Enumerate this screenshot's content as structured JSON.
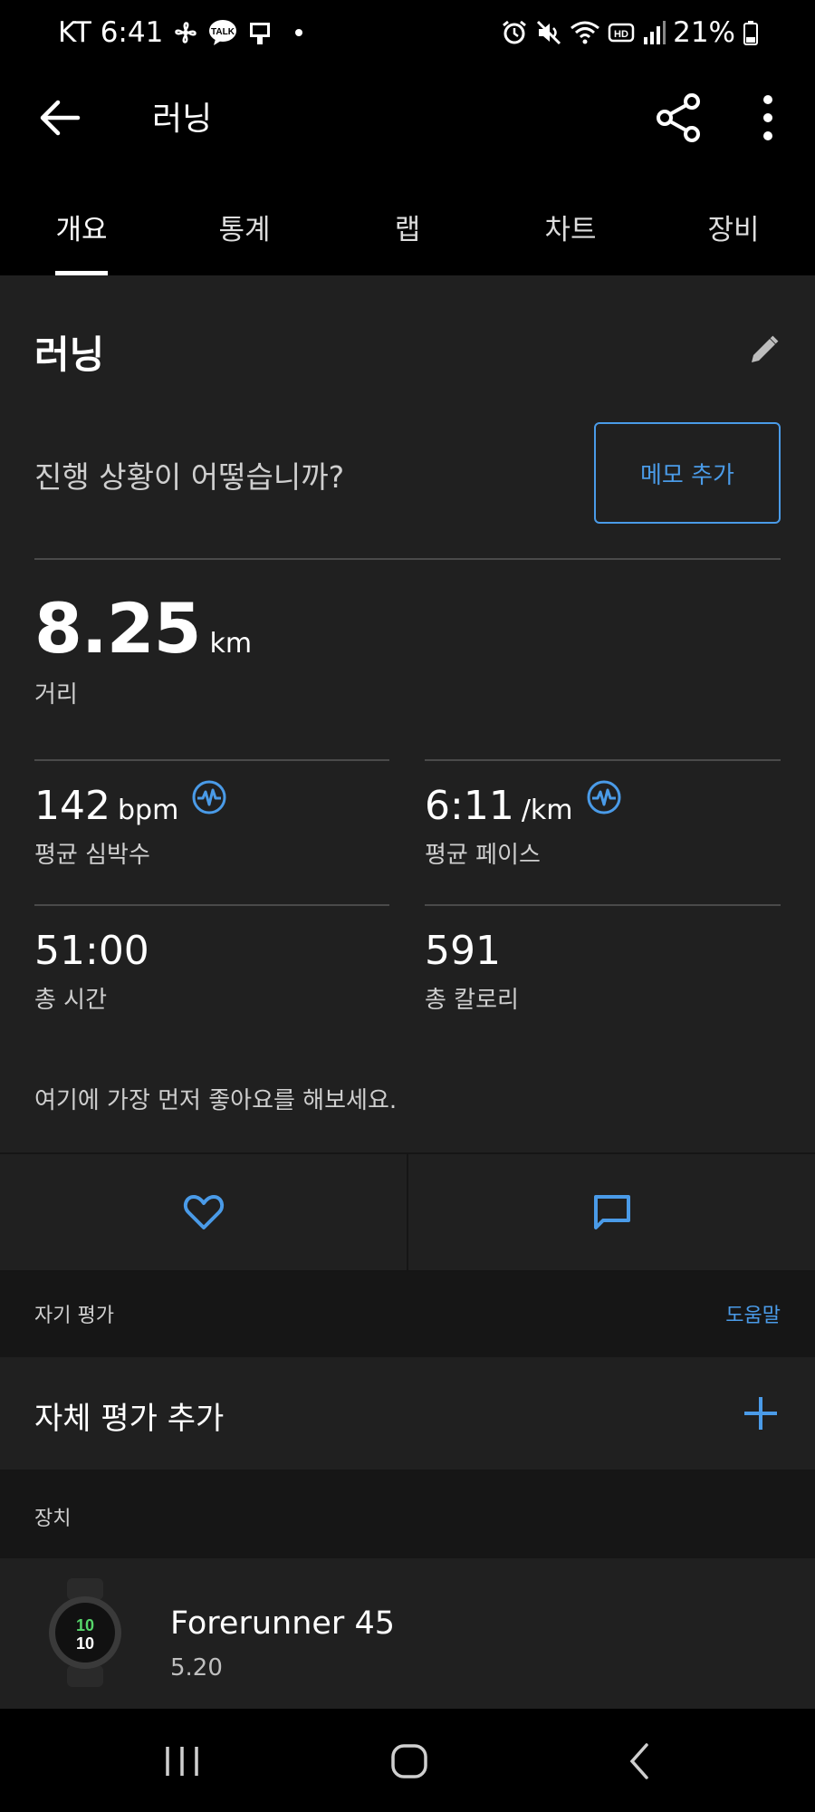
{
  "status_bar": {
    "carrier_time": "KT 6:41",
    "battery": "21%",
    "icons": [
      "pinwheel-icon",
      "talk-icon",
      "device-icon",
      "alarm-icon",
      "mute-icon",
      "wifi-icon",
      "hd-icon",
      "signal-icon",
      "battery-icon"
    ]
  },
  "app_bar": {
    "title": "러닝",
    "back_icon": "arrow-left-icon",
    "share_icon": "share-icon",
    "more_icon": "more-vert-icon"
  },
  "tabs": [
    {
      "label": "개요",
      "active": true
    },
    {
      "label": "통계",
      "active": false
    },
    {
      "label": "랩",
      "active": false
    },
    {
      "label": "차트",
      "active": false
    },
    {
      "label": "장비",
      "active": false
    }
  ],
  "overview": {
    "title": "러닝",
    "prompt": "진행 상황이 어떻습니까?",
    "memo_button": "메모 추가",
    "distance": {
      "value": "8.25",
      "unit": "km",
      "label": "거리"
    },
    "stats": [
      {
        "value": "142",
        "unit": "bpm",
        "label": "평균 심박수",
        "icon": "heart-rate-icon"
      },
      {
        "value": "6:11",
        "unit": "/km",
        "label": "평균 페이스",
        "icon": "heart-rate-icon"
      },
      {
        "value": "51:00",
        "unit": "",
        "label": "총 시간"
      },
      {
        "value": "591",
        "unit": "",
        "label": "총 칼로리"
      }
    ],
    "like_prompt": "여기에 가장 먼저 좋아요를 해보세요."
  },
  "actions": {
    "like_icon": "heart-icon",
    "comment_icon": "comment-icon"
  },
  "self_evaluation": {
    "caption": "자기 평가",
    "help": "도움말",
    "add_label": "자체 평가 추가"
  },
  "device": {
    "caption": "장치",
    "name": "Forerunner 45",
    "version": "5.20",
    "watch_face_time": "10"
  },
  "accent_color": "#4a9be8"
}
